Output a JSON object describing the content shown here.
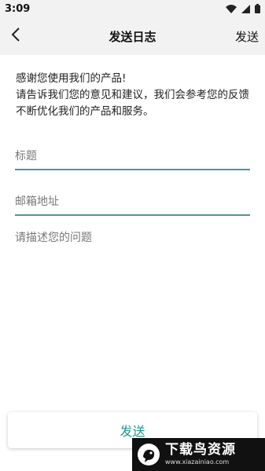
{
  "status_bar": {
    "time": "3:09",
    "icons": [
      "wifi-icon",
      "signal-icon",
      "battery-icon"
    ]
  },
  "app_bar": {
    "back_icon": "chevron-left-icon",
    "title": "发送日志",
    "send_label": "发送"
  },
  "intro": {
    "line1": "感谢您使用我们的产品!",
    "line2": "请告诉我们您的意见和建议，我们会参考您的反馈不断优化我们的产品和服务。"
  },
  "form": {
    "title_placeholder": "标题",
    "email_placeholder": "邮箱地址",
    "description_placeholder": "请描述您的问题"
  },
  "footer": {
    "send_button_label": "发送"
  },
  "watermark": {
    "brand": "下载鸟资源",
    "url": "www.xiazainiao.com"
  },
  "colors": {
    "accent": "#1a9a8e",
    "underline": "#4f93a0",
    "bar_background": "#f2f2f2"
  }
}
